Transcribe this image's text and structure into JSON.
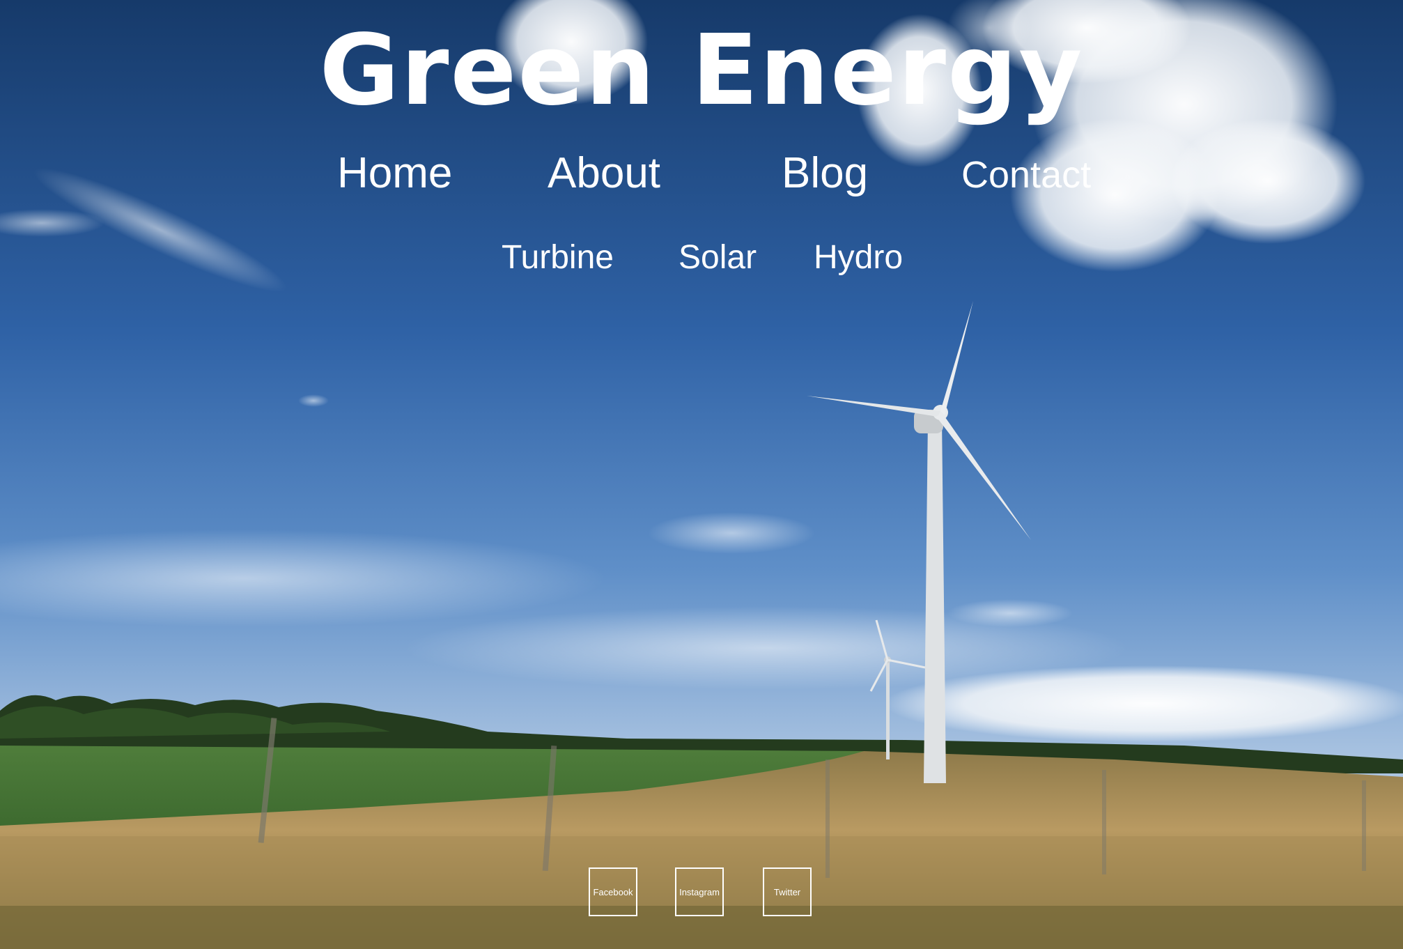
{
  "site": {
    "title": "Green Energy"
  },
  "nav": {
    "primary": [
      {
        "label": "Home"
      },
      {
        "label": "About"
      },
      {
        "label": "Blog"
      },
      {
        "label": "Contact"
      }
    ],
    "secondary": [
      {
        "label": "Turbine"
      },
      {
        "label": "Solar"
      },
      {
        "label": "Hydro"
      }
    ]
  },
  "social": [
    {
      "label": "Facebook"
    },
    {
      "label": "Instagram"
    },
    {
      "label": "Twitter"
    }
  ],
  "colors": {
    "sky_top": "#173b6c",
    "sky_mid": "#3f72b4",
    "sky_low": "#8fb2d9",
    "grass": "#4d7a3a",
    "wheat": "#b9965e",
    "text": "#ffffff"
  }
}
